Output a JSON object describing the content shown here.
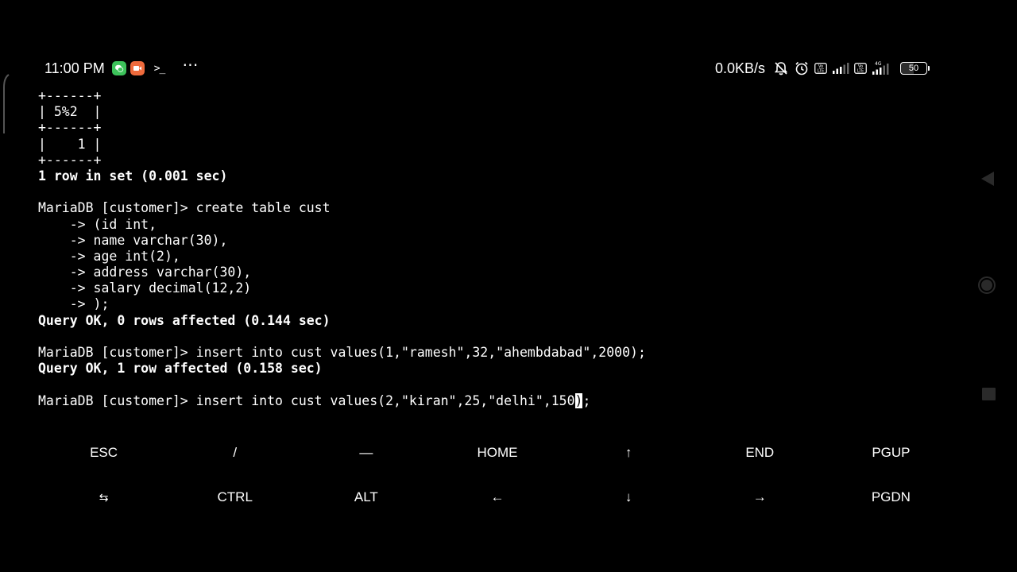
{
  "status_bar": {
    "time": "11:00 PM",
    "app_icons": [
      "wechat-icon",
      "recorder-icon"
    ],
    "terminal_glyph": ">_",
    "more": "⋯",
    "net_speed": "0.0KB/s",
    "volte1": "Vo\nLTE",
    "volte2": "Vo\nLTE",
    "network_type": "4G",
    "battery": "50",
    "battery_level": 0.5
  },
  "terminal": {
    "lines": [
      {
        "text": "+------+",
        "bold": false
      },
      {
        "text": "| 5%2  |",
        "bold": false
      },
      {
        "text": "+------+",
        "bold": false
      },
      {
        "text": "|    1 |",
        "bold": false
      },
      {
        "text": "+------+",
        "bold": false
      },
      {
        "text": "1 row in set (0.001 sec)",
        "bold": true
      },
      {
        "text": "",
        "bold": false
      },
      {
        "text": "MariaDB [customer]> create table cust",
        "bold": false
      },
      {
        "text": "    -> (id int,",
        "bold": false
      },
      {
        "text": "    -> name varchar(30),",
        "bold": false
      },
      {
        "text": "    -> age int(2),",
        "bold": false
      },
      {
        "text": "    -> address varchar(30),",
        "bold": false
      },
      {
        "text": "    -> salary decimal(12,2)",
        "bold": false
      },
      {
        "text": "    -> );",
        "bold": false
      },
      {
        "text": "Query OK, 0 rows affected (0.144 sec)",
        "bold": true
      },
      {
        "text": "",
        "bold": false
      },
      {
        "text": "MariaDB [customer]> insert into cust values(1,\"ramesh\",32,\"ahembdabad\",2000);",
        "bold": false
      },
      {
        "text": "Query OK, 1 row affected (0.158 sec)",
        "bold": true
      },
      {
        "text": "",
        "bold": false
      }
    ],
    "input_line": {
      "before_cursor": "MariaDB [customer]> insert into cust values(2,\"kiran\",25,\"delhi\",150",
      "cursor_char": ")",
      "after_cursor": ";"
    }
  },
  "extra_keys": {
    "row1": [
      "ESC",
      "/",
      "—",
      "HOME",
      "↑",
      "END",
      "PGUP"
    ],
    "row2": [
      "⇆",
      "CTRL",
      "ALT",
      "←",
      "↓",
      "→",
      "PGDN"
    ]
  },
  "colors": {
    "background": "#000000",
    "foreground": "#ffffff",
    "nav_buttons": "#2a2a2a"
  }
}
